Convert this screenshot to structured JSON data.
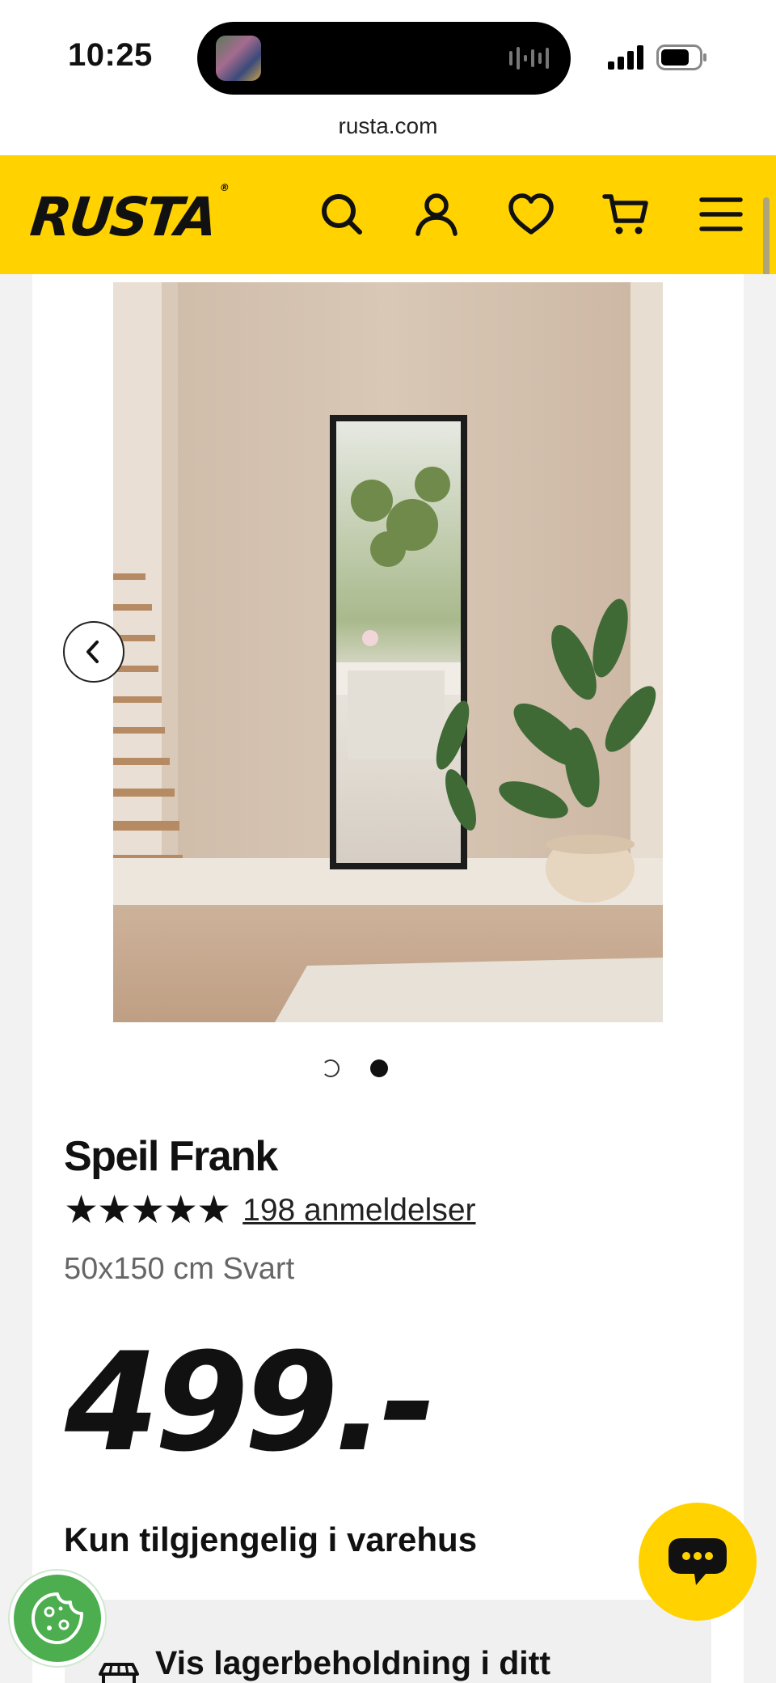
{
  "status_bar": {
    "time": "10:25",
    "icons": [
      "now-playing-thumbnail",
      "audio-waveform-icon",
      "cellular-signal-icon",
      "battery-icon"
    ]
  },
  "browser": {
    "url": "rusta.com"
  },
  "header": {
    "logo_text": "RUSTA",
    "logo_mark": "®",
    "background_color": "#ffd200",
    "icons": [
      "search-icon",
      "account-icon",
      "wishlist-heart-icon",
      "cart-icon",
      "menu-icon"
    ]
  },
  "product": {
    "title": "Speil Frank",
    "rating_stars": "★★★★★",
    "rating_value": 5,
    "reviews_label": "198 anmeldelser",
    "variant": "50x150 cm Svart",
    "price": "499.-",
    "availability": "Kun tilgjengelig i varehus",
    "stock_link": "Vis lagerbeholdning i ditt"
  },
  "carousel": {
    "slide_count": 2,
    "active_slide": 2
  },
  "colors": {
    "brand_yellow": "#ffd200",
    "cookie_green": "#4cae4f",
    "text_dark": "#111111"
  }
}
